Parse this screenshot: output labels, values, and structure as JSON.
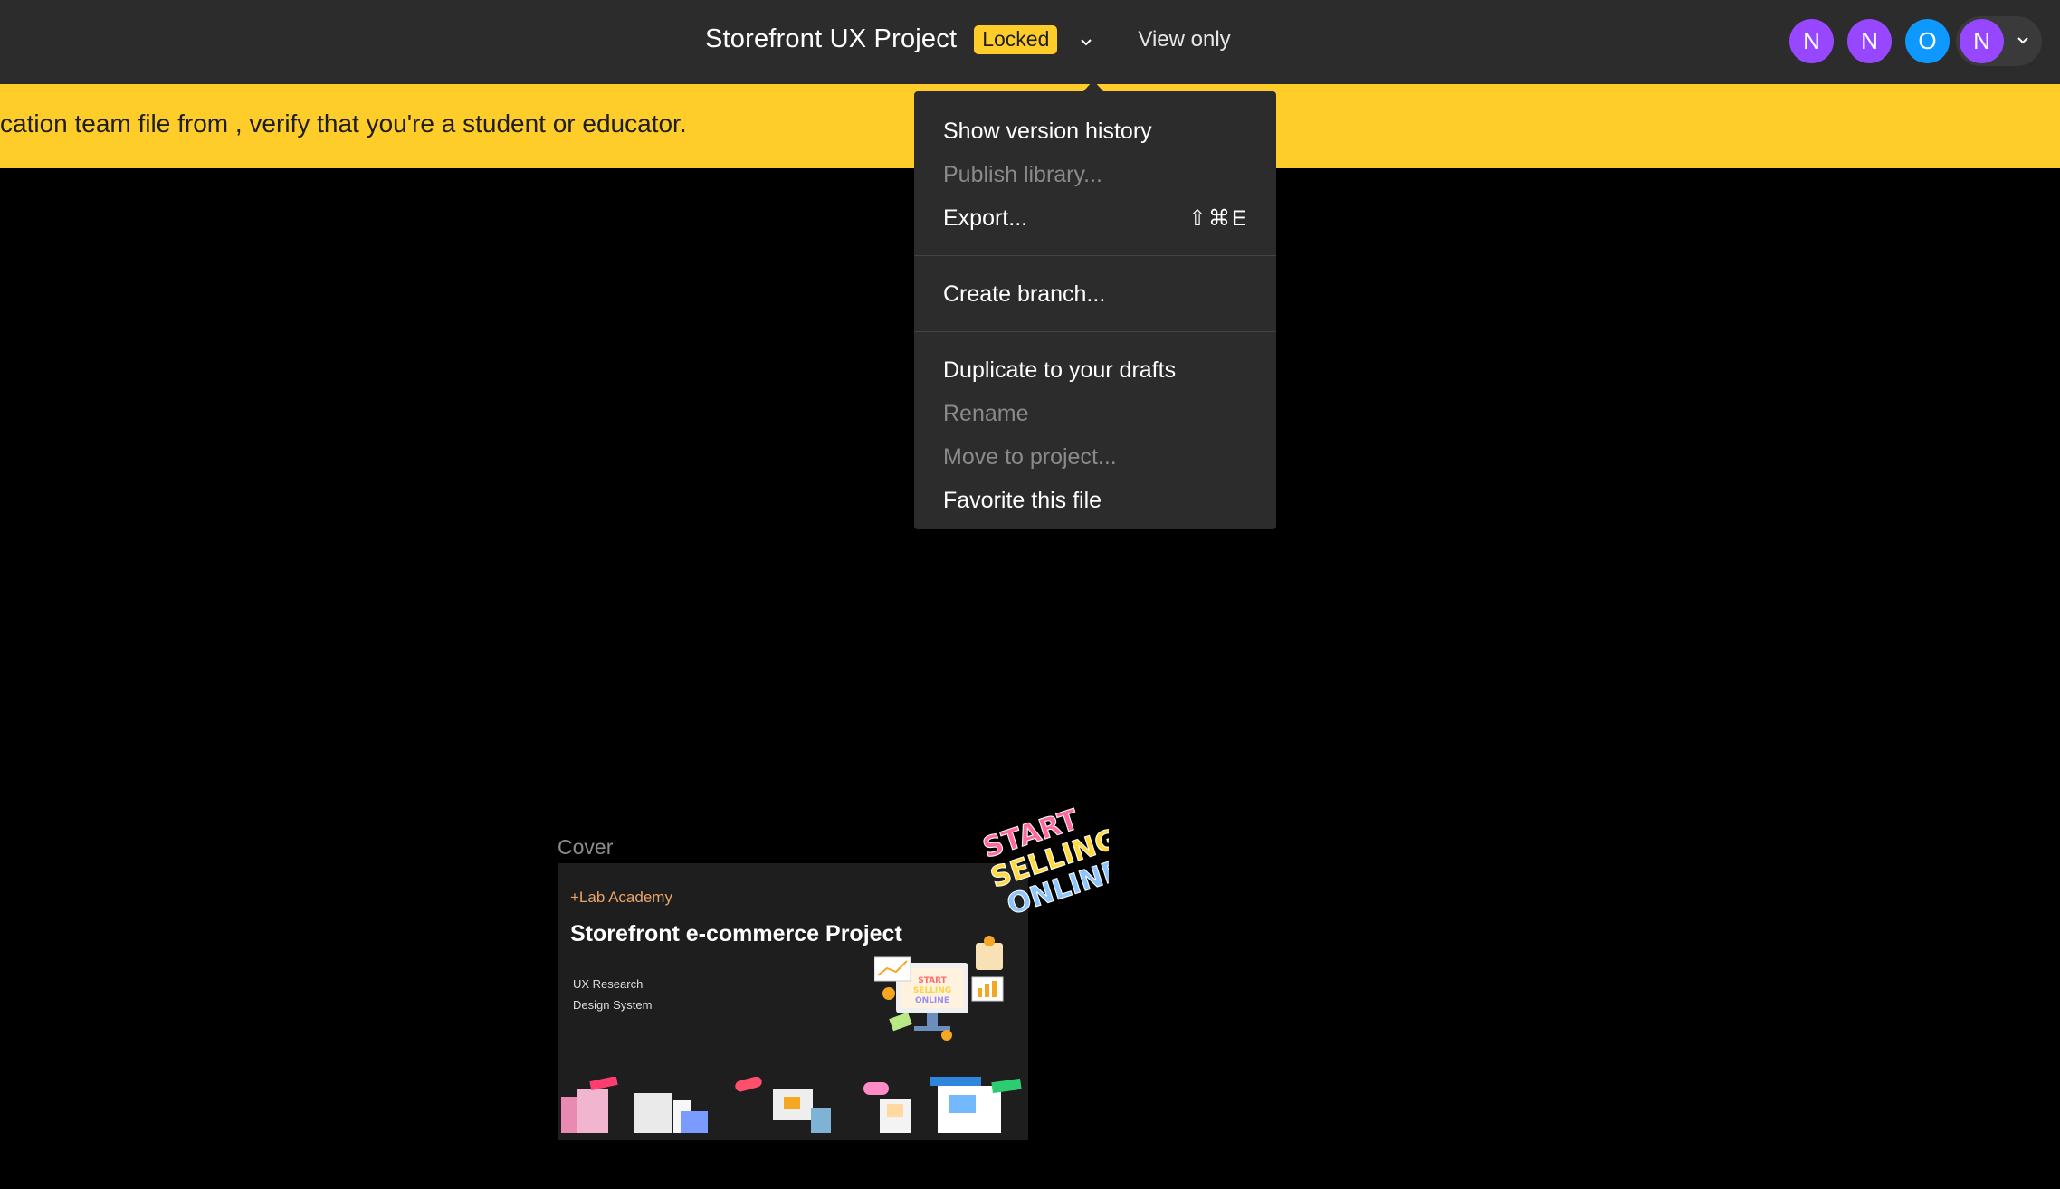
{
  "topbar": {
    "file_title": "Storefront UX Project",
    "locked_badge": "Locked",
    "view_only_label": "View only",
    "avatars": [
      {
        "initial": "N",
        "color": "#9747ff"
      },
      {
        "initial": "N",
        "color": "#9747ff"
      },
      {
        "initial": "O",
        "color": "#0d99ff"
      },
      {
        "initial": "N",
        "color": "#9747ff"
      }
    ]
  },
  "banner": {
    "text": "cation team file from , verify that you're a student or educator."
  },
  "file_menu": {
    "items": [
      {
        "label": "Show version history"
      },
      {
        "label": "Publish library...",
        "disabled": true
      },
      {
        "label": "Export...",
        "shortcut": "⇧⌘E"
      },
      {
        "label": "Create branch..."
      },
      {
        "label": "Duplicate to your drafts"
      },
      {
        "label": "Rename",
        "disabled": true
      },
      {
        "label": "Move to project...",
        "disabled": true
      },
      {
        "label": "Favorite this file"
      }
    ]
  },
  "canvas": {
    "frame_label": "Cover",
    "cover": {
      "org": "+Lab Academy",
      "title": "Storefront e-commerce Project",
      "sub1": "UX Research",
      "sub2": "Design System"
    },
    "sticker_text": "START SELLING ONLINE"
  },
  "colors": {
    "accent_yellow": "#ffcd29",
    "topbar_bg": "#2c2c2c",
    "avatar_purple": "#9747ff",
    "avatar_blue": "#0d99ff"
  }
}
